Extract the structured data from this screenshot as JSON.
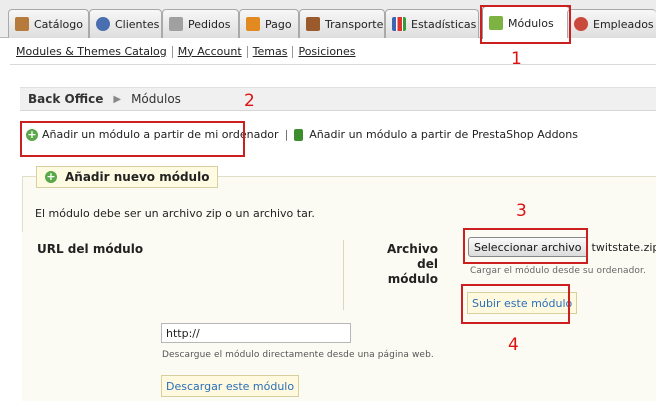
{
  "tabs": [
    {
      "label": "Catálogo",
      "icon": "catalog-icon",
      "color": "#b57a3c"
    },
    {
      "label": "Clientes",
      "icon": "customers-icon",
      "color": "#4a6fb0"
    },
    {
      "label": "Pedidos",
      "icon": "orders-icon",
      "color": "#909090"
    },
    {
      "label": "Pago",
      "icon": "payment-icon",
      "color": "#e28a1f"
    },
    {
      "label": "Transporte",
      "icon": "shipping-icon",
      "color": "#9a5a2c"
    },
    {
      "label": "Estadísticas",
      "icon": "stats-icon",
      "color": "#3b66b8"
    },
    {
      "label": "Módulos",
      "icon": "modules-icon",
      "color": "#7cb342",
      "active": true
    },
    {
      "label": "Empleados",
      "icon": "employees-icon",
      "color": "#c94a3a"
    }
  ],
  "subnav": [
    "Modules & Themes Catalog",
    "My Account",
    "Temas",
    "Posiciones"
  ],
  "breadcrumb": {
    "root": "Back Office",
    "current": "Módulos"
  },
  "add_links": {
    "from_computer": "Añadir un módulo a partir de mi ordenador",
    "separator": "|",
    "from_addons": "Añadir un módulo a partir de PrestaShop Addons"
  },
  "form": {
    "legend": "Añadir nuevo módulo",
    "note": "El módulo debe ser un archivo zip o un archivo tar.",
    "url_label": "URL del módulo",
    "file_label": "Archivo del módulo",
    "file_button": "Seleccionar archivo",
    "file_name": "twitstate.zip",
    "file_hint": "Cargar el módulo desde su ordenador.",
    "upload_button": "Subir este módulo",
    "url_value": "http://",
    "url_hint": "Descargue el módulo directamente desde una página web.",
    "download_button": "Descargar este módulo"
  },
  "annotations": [
    "1",
    "2",
    "3",
    "4"
  ],
  "colors": {
    "annotation": "#cc1f1f",
    "link_blue": "#2a6fb8",
    "panel_bg": "#fbfbf3"
  }
}
